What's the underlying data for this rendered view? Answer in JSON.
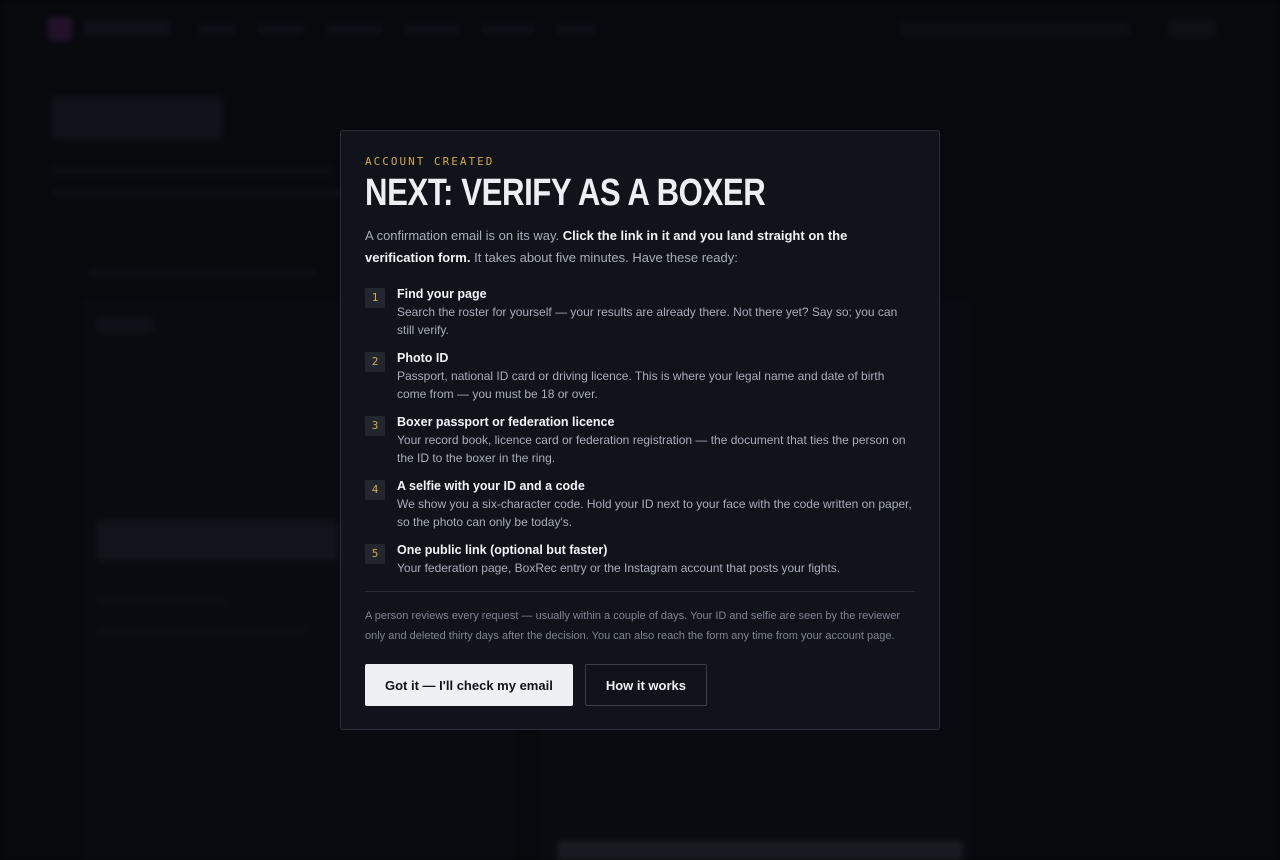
{
  "modal": {
    "eyebrow": "ACCOUNT CREATED",
    "title": "NEXT: VERIFY AS A BOXER",
    "intro_before": "A confirmation email is on its way. ",
    "intro_bold": "Click the link in it and you land straight on the verification form.",
    "intro_after": " It takes about five minutes. Have these ready:",
    "steps": [
      {
        "number": "1",
        "title": "Find your page",
        "description": "Search the roster for yourself — your results are already there. Not there yet? Say so; you can still verify."
      },
      {
        "number": "2",
        "title": "Photo ID",
        "description": "Passport, national ID card or driving licence. This is where your legal name and date of birth come from — you must be 18 or over."
      },
      {
        "number": "3",
        "title": "Boxer passport or federation licence",
        "description": "Your record book, licence card or federation registration — the document that ties the person on the ID to the boxer in the ring."
      },
      {
        "number": "4",
        "title": "A selfie with your ID and a code",
        "description": "We show you a six-character code. Hold your ID next to your face with the code written on paper, so the photo can only be today's."
      },
      {
        "number": "5",
        "title": "One public link (optional but faster)",
        "description": "Your federation page, BoxRec entry or the Instagram account that posts your fights."
      }
    ],
    "fineprint": "A person reviews every request — usually within a couple of days. Your ID and selfie are seen by the reviewer only and deleted thirty days after the decision. You can also reach the form any time from your account page.",
    "primary_button": "Got it — I'll check my email",
    "secondary_button": "How it works"
  },
  "colors": {
    "accent": "#d2a94a",
    "modal_background": "#10131a",
    "page_background": "#0b0d12"
  }
}
